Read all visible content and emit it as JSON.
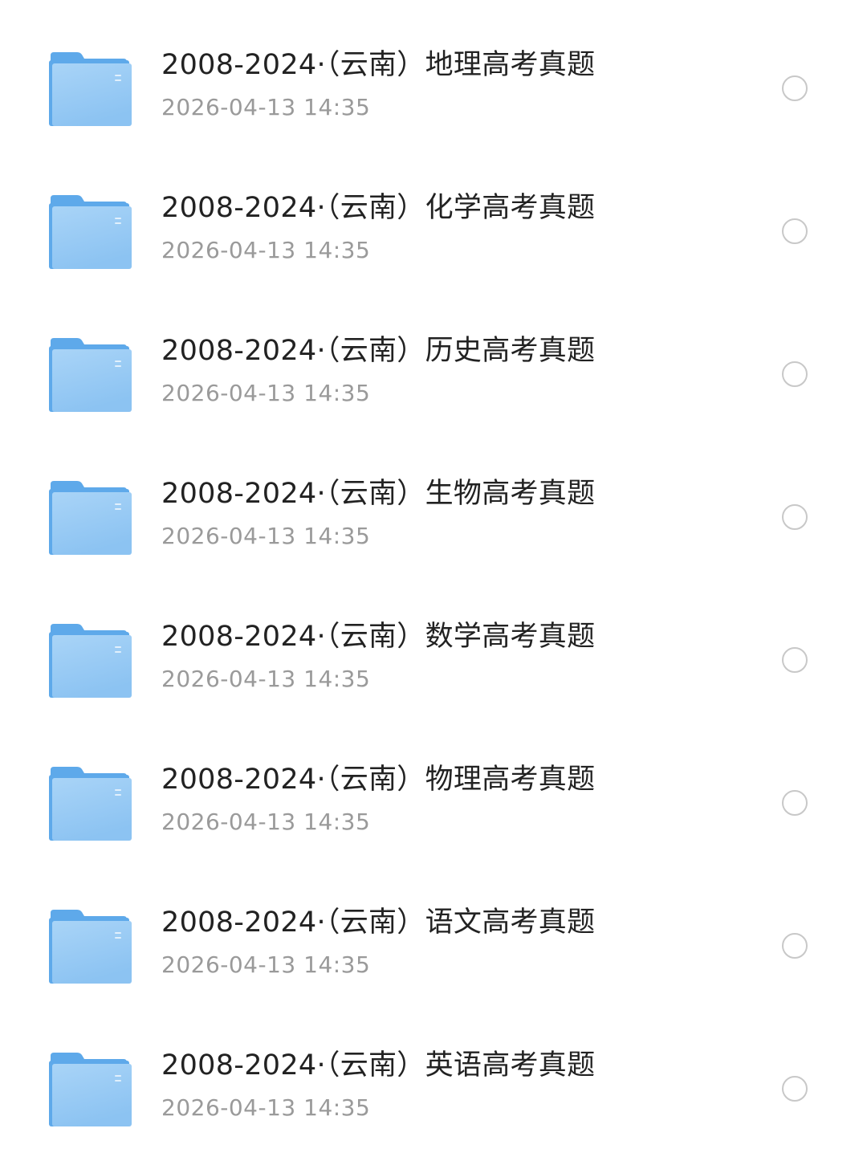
{
  "files": [
    {
      "name": "2008-2024·（云南）地理高考真题",
      "date": "2026-04-13 14:35",
      "icon": "folder-icon"
    },
    {
      "name": "2008-2024·（云南）化学高考真题",
      "date": "2026-04-13 14:35",
      "icon": "folder-icon"
    },
    {
      "name": "2008-2024·（云南）历史高考真题",
      "date": "2026-04-13 14:35",
      "icon": "folder-icon"
    },
    {
      "name": "2008-2024·（云南）生物高考真题",
      "date": "2026-04-13 14:35",
      "icon": "folder-icon"
    },
    {
      "name": "2008-2024·（云南）数学高考真题",
      "date": "2026-04-13 14:35",
      "icon": "folder-icon"
    },
    {
      "name": "2008-2024·（云南）物理高考真题",
      "date": "2026-04-13 14:35",
      "icon": "folder-icon"
    },
    {
      "name": "2008-2024·（云南）语文高考真题",
      "date": "2026-04-13 14:35",
      "icon": "folder-icon"
    },
    {
      "name": "2008-2024·（云南）英语高考真题",
      "date": "2026-04-13 14:35",
      "icon": "folder-icon"
    }
  ],
  "colors": {
    "folder_back": "#5ea9ea",
    "folder_front_top": "#a9d4f7",
    "folder_front_bottom": "#8cc3f2",
    "name_text": "#222222",
    "date_text": "#9a9a9a",
    "radio_border": "#c8c8c8"
  }
}
